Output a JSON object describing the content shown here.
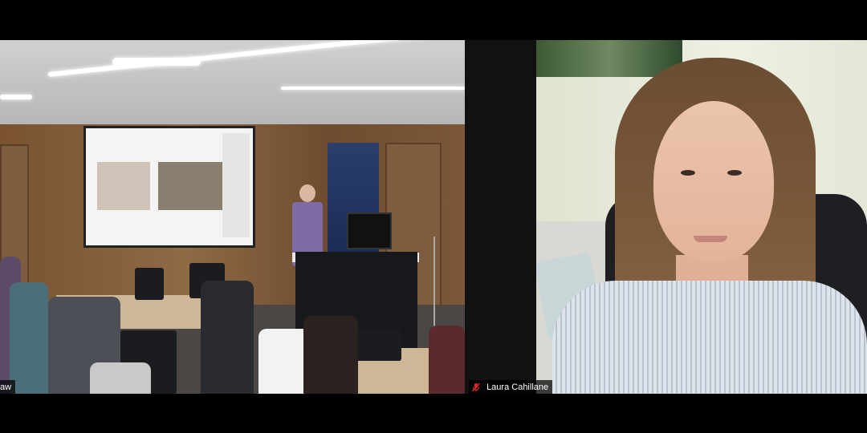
{
  "window": {
    "layout": "gallery-view",
    "background_color": "#000000"
  },
  "participants": [
    {
      "id": "left-tile",
      "name_label": "aw",
      "muted": false,
      "scene": "classroom-with-presenter"
    },
    {
      "id": "right-tile",
      "name_label": "Laura Cahillane",
      "muted": true,
      "mute_icon": "mic-muted-icon",
      "mute_icon_color": "#e02828",
      "scene": "remote-speaker-webcam"
    }
  ]
}
